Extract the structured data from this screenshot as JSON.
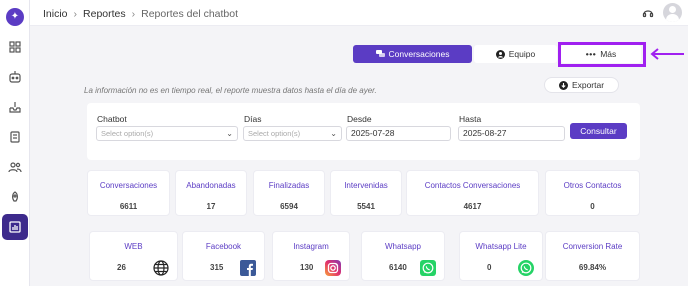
{
  "breadcrumb": [
    "Inicio",
    "Reportes",
    "Reportes del chatbot"
  ],
  "tabs": {
    "conversaciones": "Conversaciones",
    "equipo": "Equipo",
    "mas": "Más"
  },
  "info_text": "La información no es en tiempo real, el reporte muestra datos hasta el día de ayer.",
  "export_label": "Exportar",
  "filters": {
    "chatbot": {
      "label": "Chatbot",
      "placeholder": "Select option(s)"
    },
    "dias": {
      "label": "Días",
      "placeholder": "Select option(s)"
    },
    "desde": {
      "label": "Desde",
      "value": "2025-07-28"
    },
    "hasta": {
      "label": "Hasta",
      "value": "2025-08-27"
    },
    "consultar": "Consultar"
  },
  "stats": [
    {
      "label": "Conversaciones",
      "value": "6611"
    },
    {
      "label": "Abandonadas",
      "value": "17"
    },
    {
      "label": "Finalizadas",
      "value": "6594"
    },
    {
      "label": "Intervenidas",
      "value": "5541"
    },
    {
      "label": "Contactos Conversaciones",
      "value": "4617"
    },
    {
      "label": "Otros Contactos",
      "value": "0"
    }
  ],
  "channels": [
    {
      "label": "WEB",
      "value": "26",
      "icon": "globe-icon"
    },
    {
      "label": "Facebook",
      "value": "315",
      "icon": "facebook-icon"
    },
    {
      "label": "Instagram",
      "value": "130",
      "icon": "instagram-icon"
    },
    {
      "label": "Whatsapp",
      "value": "6140",
      "icon": "whatsapp-icon"
    },
    {
      "label": "Whatsapp Lite",
      "value": "0",
      "icon": "whatsapp-icon"
    },
    {
      "label": "Conversion Rate",
      "value": "69.84%"
    }
  ],
  "colors": {
    "accent": "#5b3cc4",
    "highlight": "#a020f0",
    "sidebar_active": "#3d2a8c"
  }
}
